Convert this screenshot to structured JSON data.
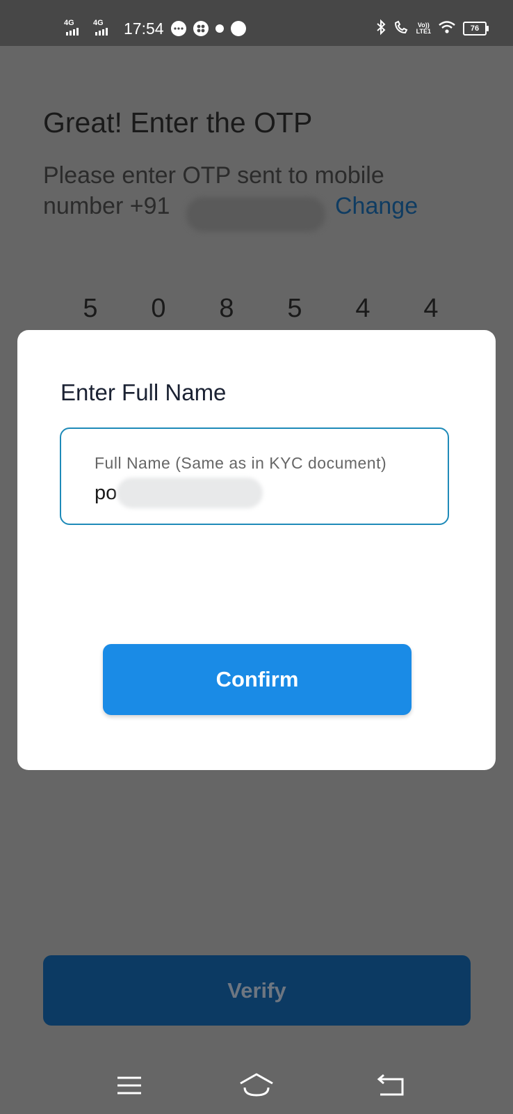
{
  "status_bar": {
    "signal1_tag": "4G",
    "signal2_tag": "4G",
    "time": "17:54",
    "volte_top": "Vo))",
    "volte_bottom": "LTE1",
    "battery": "76"
  },
  "otp_screen": {
    "title": "Great! Enter the OTP",
    "description_line1": "Please enter OTP sent to mobile",
    "description_line2_prefix": "number +91",
    "change_label": "Change",
    "digits": [
      "5",
      "0",
      "8",
      "5",
      "4",
      "4"
    ]
  },
  "dialog": {
    "title": "Enter Full Name",
    "field_label": "Full Name (Same as in KYC document)",
    "field_value": "po",
    "confirm_label": "Confirm"
  },
  "verify_label": "Verify",
  "colors": {
    "overlay_background": "#666666",
    "status_bar": "#474747",
    "confirm_button": "#1a8be6",
    "verify_button": "#0c3a63",
    "field_border": "#1e8ab8",
    "link": "#0f3c62"
  },
  "icons": {
    "nav_menu": "menu-icon",
    "nav_home": "home-icon",
    "nav_back": "back-icon"
  }
}
